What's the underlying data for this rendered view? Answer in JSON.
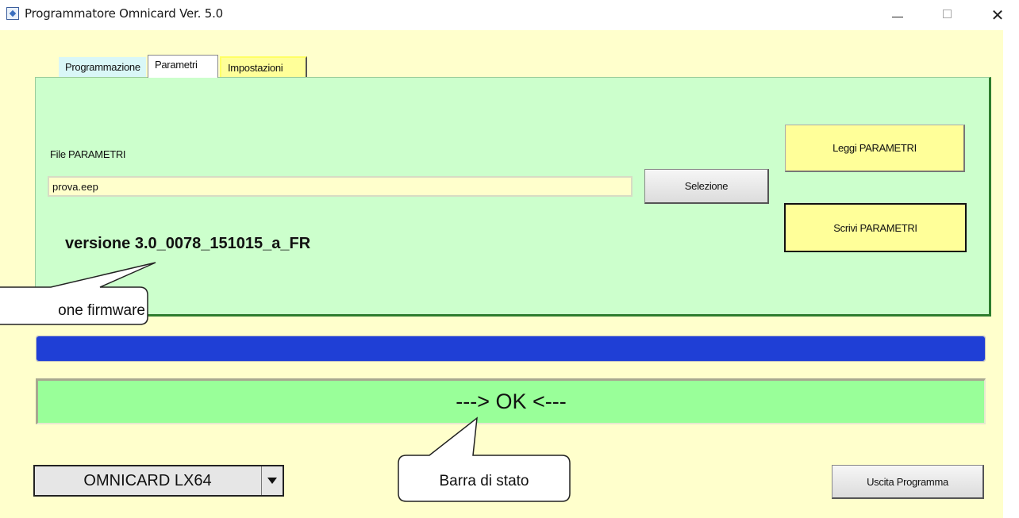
{
  "window": {
    "title": "Programmatore Omnicard Ver. 5.0",
    "minimize_glyph": "minimize-icon",
    "maximize_glyph": "maximize-icon",
    "close_glyph": "✕"
  },
  "tabs": [
    {
      "label": "Programmazione",
      "active": false
    },
    {
      "label": "Parametri",
      "active": true
    },
    {
      "label": "Impostazioni",
      "active": false
    }
  ],
  "parametri": {
    "file_label": "File PARAMETRI",
    "file_value": "prova.eep",
    "select_button": "Selezione",
    "read_button": "Leggi PARAMETRI",
    "write_button": "Scrivi PARAMETRI",
    "version": "versione 3.0_0078_151015_a_FR"
  },
  "progress": {
    "value": 1.0,
    "color": "#1f3fd6"
  },
  "status": {
    "text": "---> OK <---",
    "color": "#99ff99"
  },
  "device_select": {
    "selected": "OMNICARD LX64"
  },
  "exit_button": "Uscita Programma",
  "callouts": {
    "firmware": "one firmware",
    "status_bar": "Barra di stato"
  },
  "colors": {
    "background": "#ffffcc",
    "panel": "#ccffcc",
    "button_yellow": "#ffff99"
  }
}
